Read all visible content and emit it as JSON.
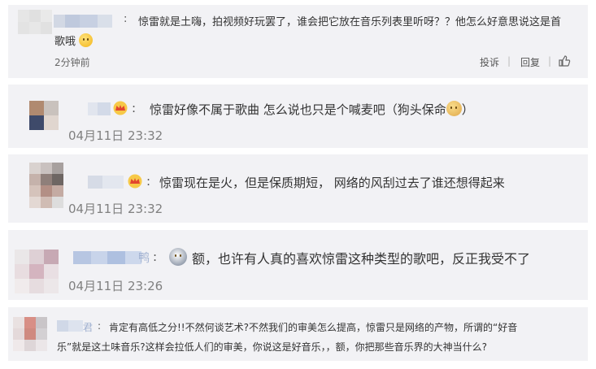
{
  "comments": [
    {
      "author": "Blurred username",
      "text_line1": "惊雷就是土嗨，拍视频好玩罢了，谁会把它放在音乐列表里听呀？？他怎么好意思说这是首",
      "text_line2": "歌哦",
      "time": "2分钟前",
      "actions": {
        "report": "投诉",
        "reply": "回复",
        "separator": "|"
      }
    },
    {
      "author": "Blurred username",
      "text": "惊雷好像不属于歌曲 怎么说也只是个喊麦吧（狗头保命",
      "text_end": "）",
      "time": "04月11日 23:32"
    },
    {
      "author": "Blurred username",
      "text": "惊雷现在是火，但是保质期短， 网络的风刮过去了谁还想得起来",
      "time": "04月11日 23:32"
    },
    {
      "author": "Blurred username",
      "author_tail": "鸭",
      "text": "额，也许有人真的喜欢惊雷这种类型的歌吧，反正我受不了",
      "time": "04月11日 23:26"
    },
    {
      "author": "Blurred username",
      "author_tail": "君",
      "text_line1": "肯定有高低之分!!不然何谈艺术?不然我们的审美怎么提高，惊雷只是网络的产物，所谓的“好音",
      "text_line2": "乐”就是这土味音乐?这样会拉低人们的审美，你说这是好音乐，，额，你把那些音乐界的大神当什么?"
    }
  ],
  "colors": {
    "card_bg": "#f2f2f5",
    "text": "#333333",
    "meta": "#808080",
    "emoji": "#f2b51a"
  }
}
